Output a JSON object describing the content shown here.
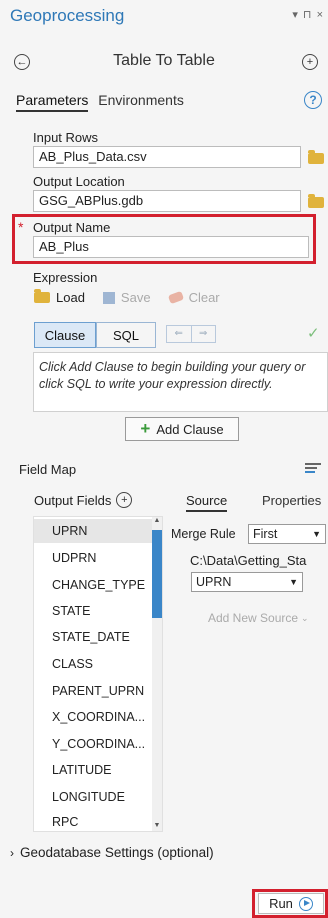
{
  "panel": {
    "title": "Geoprocessing",
    "window_controls": "▾ ⊓ ×",
    "tool_title": "Table To Table",
    "tabs": [
      {
        "label": "Parameters"
      },
      {
        "label": "Environments"
      }
    ],
    "help_label": "?"
  },
  "params": {
    "input_rows_label": "Input Rows",
    "input_rows_value": "AB_Plus_Data.csv",
    "output_location_label": "Output Location",
    "output_location_value": "GSG_ABPlus.gdb",
    "required_marker": "*",
    "output_name_label": "Output Name",
    "output_name_value": "AB_Plus",
    "expression_label": "Expression"
  },
  "expression": {
    "load": "Load",
    "save": "Save",
    "clear": "Clear",
    "clause": "Clause",
    "sql": "SQL",
    "hint": "Click Add Clause to begin building your query or click SQL to write your expression directly.",
    "add_clause": "Add Clause"
  },
  "field_map": {
    "label": "Field Map",
    "output_fields_header": "Output Fields",
    "source_tab": "Source",
    "properties_tab": "Properties",
    "fields": [
      "UPRN",
      "UDPRN",
      "CHANGE_TYPE",
      "STATE",
      "STATE_DATE",
      "CLASS",
      "PARENT_UPRN",
      "X_COORDINA...",
      "Y_COORDINA...",
      "LATITUDE",
      "LONGITUDE",
      "RPC"
    ],
    "merge_rule_label": "Merge Rule",
    "merge_rule_value": "First",
    "source_path": "C:\\Data\\Getting_Sta",
    "source_field": "UPRN",
    "add_new_source": "Add New Source"
  },
  "geodatabase_settings": "Geodatabase Settings (optional)",
  "run_label": "Run",
  "colors": {
    "accent": "#2e78b7",
    "highlight": "#d3202e"
  }
}
